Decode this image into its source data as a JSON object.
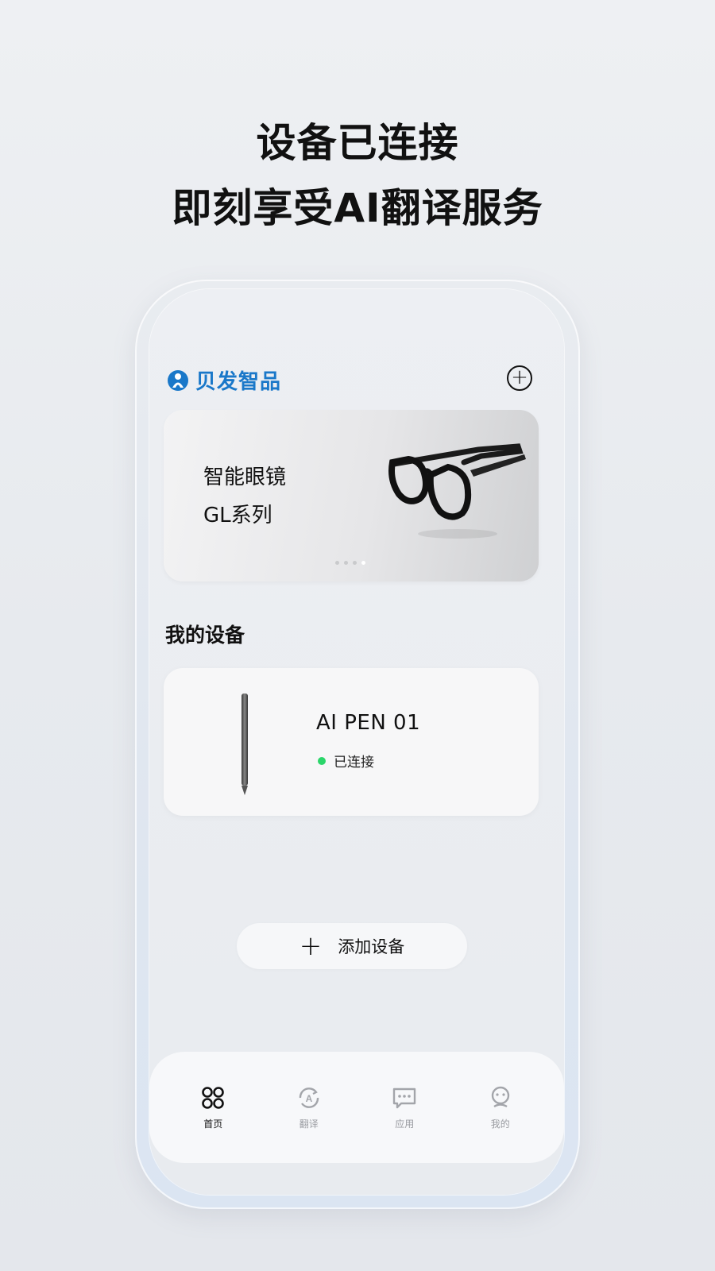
{
  "promo": {
    "line1": "设备已连接",
    "line2": "即刻享受AI翻译服务"
  },
  "app": {
    "brand": "贝发智品",
    "brand_color": "#1a78c9"
  },
  "banner": {
    "title": "智能眼镜",
    "subtitle": "GL系列",
    "pages_total": 4,
    "active_page": 4
  },
  "devices": {
    "section_title": "我的设备",
    "items": [
      {
        "name": "AI PEN 01",
        "status": "已连接",
        "status_color": "#2bd66a"
      }
    ]
  },
  "actions": {
    "add_device_label": "添加设备"
  },
  "tabbar": {
    "items": [
      {
        "label": "首页",
        "icon": "home-grid-icon",
        "active": true
      },
      {
        "label": "翻译",
        "icon": "translate-icon",
        "active": false
      },
      {
        "label": "应用",
        "icon": "apps-chat-icon",
        "active": false
      },
      {
        "label": "我的",
        "icon": "profile-icon",
        "active": false
      }
    ]
  }
}
